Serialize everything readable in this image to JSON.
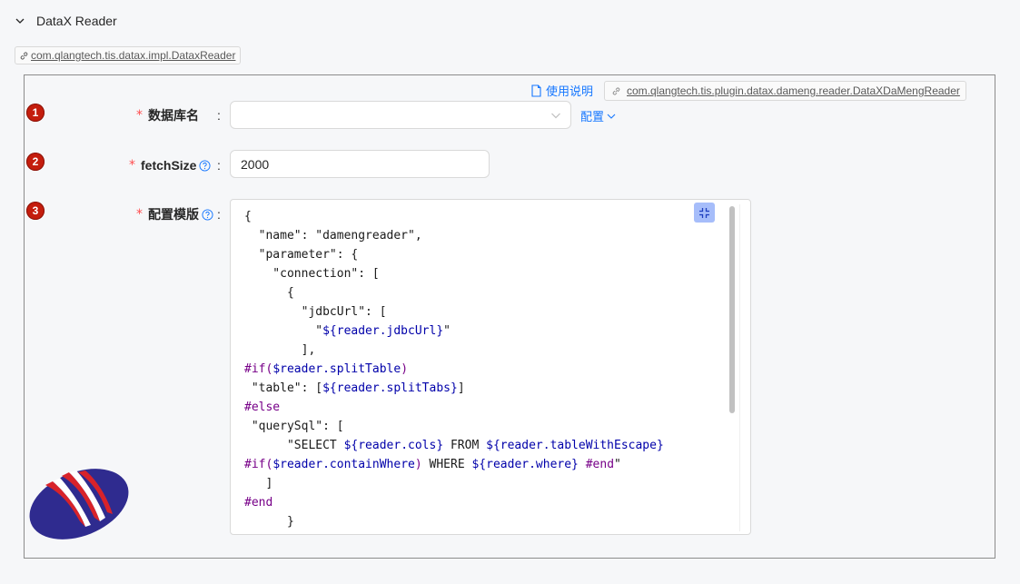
{
  "section": {
    "title": "DataX Reader",
    "toggle_icon": "chevron-down-icon"
  },
  "plugin_tag": {
    "text": "com.qlangtech.tis.datax.impl.DataxReader",
    "icon": "link-icon"
  },
  "doc": {
    "label": "使用说明",
    "icon": "file-icon"
  },
  "impl_tag": {
    "text": "com.qlangtech.tis.plugin.datax.dameng.reader.DataXDaMengReader",
    "icon": "link-icon"
  },
  "fields": [
    {
      "index": "1",
      "required_mark": "*",
      "label": "数据库名",
      "colon": ":",
      "value": "",
      "extra_link": "配置"
    },
    {
      "index": "2",
      "required_mark": "*",
      "label": "fetchSize",
      "colon": ":",
      "value": "2000",
      "help_icon": "question-circle-icon"
    },
    {
      "index": "3",
      "required_mark": "*",
      "label": "配置模版",
      "colon": ":",
      "help_icon": "question-circle-icon"
    }
  ],
  "editor": {
    "lines": [
      [
        {
          "t": "{",
          "c": ""
        }
      ],
      [
        {
          "t": "  \"name\": \"damengreader\",",
          "c": ""
        }
      ],
      [
        {
          "t": "  \"parameter\": {",
          "c": ""
        }
      ],
      [
        {
          "t": "    \"connection\": [",
          "c": ""
        }
      ],
      [
        {
          "t": "      {",
          "c": ""
        }
      ],
      [
        {
          "t": "        \"jdbcUrl\": [",
          "c": ""
        }
      ],
      [
        {
          "t": "          \"",
          "c": ""
        },
        {
          "t": "${reader.jdbcUrl}",
          "c": "v"
        },
        {
          "t": "\"",
          "c": ""
        }
      ],
      [
        {
          "t": "        ],",
          "c": ""
        }
      ],
      [
        {
          "t": "#if(",
          "c": "d"
        },
        {
          "t": "$reader.splitTable",
          "c": "v"
        },
        {
          "t": ")",
          "c": "d"
        }
      ],
      [
        {
          "t": " \"table\": [",
          "c": ""
        },
        {
          "t": "${reader.splitTabs}",
          "c": "v"
        },
        {
          "t": "]",
          "c": ""
        }
      ],
      [
        {
          "t": "#else",
          "c": "d"
        }
      ],
      [
        {
          "t": " \"querySql\": [",
          "c": ""
        }
      ],
      [
        {
          "t": "      \"SELECT ",
          "c": ""
        },
        {
          "t": "${reader.cols}",
          "c": "v"
        },
        {
          "t": " FROM ",
          "c": ""
        },
        {
          "t": "${reader.tableWithEscape}",
          "c": "v"
        }
      ],
      [
        {
          "t": "#if(",
          "c": "d"
        },
        {
          "t": "$reader.containWhere",
          "c": "v"
        },
        {
          "t": ")",
          "c": "d"
        },
        {
          "t": " WHERE ",
          "c": ""
        },
        {
          "t": "${reader.where}",
          "c": "v"
        },
        {
          "t": " ",
          "c": ""
        },
        {
          "t": "#end",
          "c": "d"
        },
        {
          "t": "\"",
          "c": ""
        }
      ],
      [
        {
          "t": "   ]",
          "c": ""
        }
      ],
      [
        {
          "t": "#end",
          "c": "d"
        }
      ],
      [
        {
          "t": "      }",
          "c": ""
        }
      ]
    ],
    "fullscreen_icon": "fullscreen-exit-icon"
  },
  "logo_icon": "tis-logo-icon",
  "colors": {
    "link": "#1677ff",
    "badge": "#c41d0d",
    "required": "#ff4d4f",
    "directive": "#770088",
    "variable": "#0000aa"
  }
}
